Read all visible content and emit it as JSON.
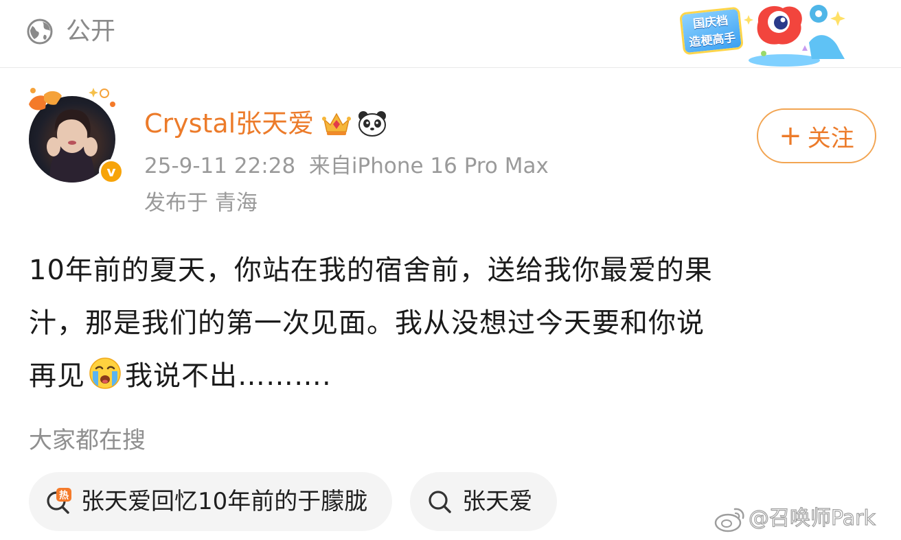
{
  "header": {
    "visibility_label": "公开",
    "promo_badge_line1": "国庆档",
    "promo_badge_line2": "造梗高手"
  },
  "author": {
    "name": "Crystal张天爱",
    "avatar_badge": "v",
    "timestamp": "25-9-11 22:28",
    "source": "来自iPhone 16 Pro Max",
    "location": "发布于 青海",
    "follow_plus": "+",
    "follow_label": "关注"
  },
  "post": {
    "line1": "10年前的夏天，你站在我的宿舍前，送给我你最爱的果",
    "line2": "汁，那是我们的第一次见面。我从没想过今天要和你说",
    "line3_before_emoji": "再见",
    "line3_after_emoji": "我说不出……….",
    "emoji": "crying-face"
  },
  "search": {
    "title": "大家都在搜",
    "hot_badge": "热",
    "chips": [
      {
        "label": "张天爱回忆10年前的于朦胧",
        "icon": "hot-search-icon"
      },
      {
        "label": "张天爱",
        "icon": "search-icon"
      }
    ]
  },
  "watermark": {
    "text": "@召唤师Park"
  },
  "colors": {
    "accent_orange": "#ec7b2a",
    "follow_border": "#f2a451",
    "meta_gray": "#9a9a9a",
    "chip_bg": "#f4f4f4",
    "verified_gold": "#f7a40a"
  }
}
